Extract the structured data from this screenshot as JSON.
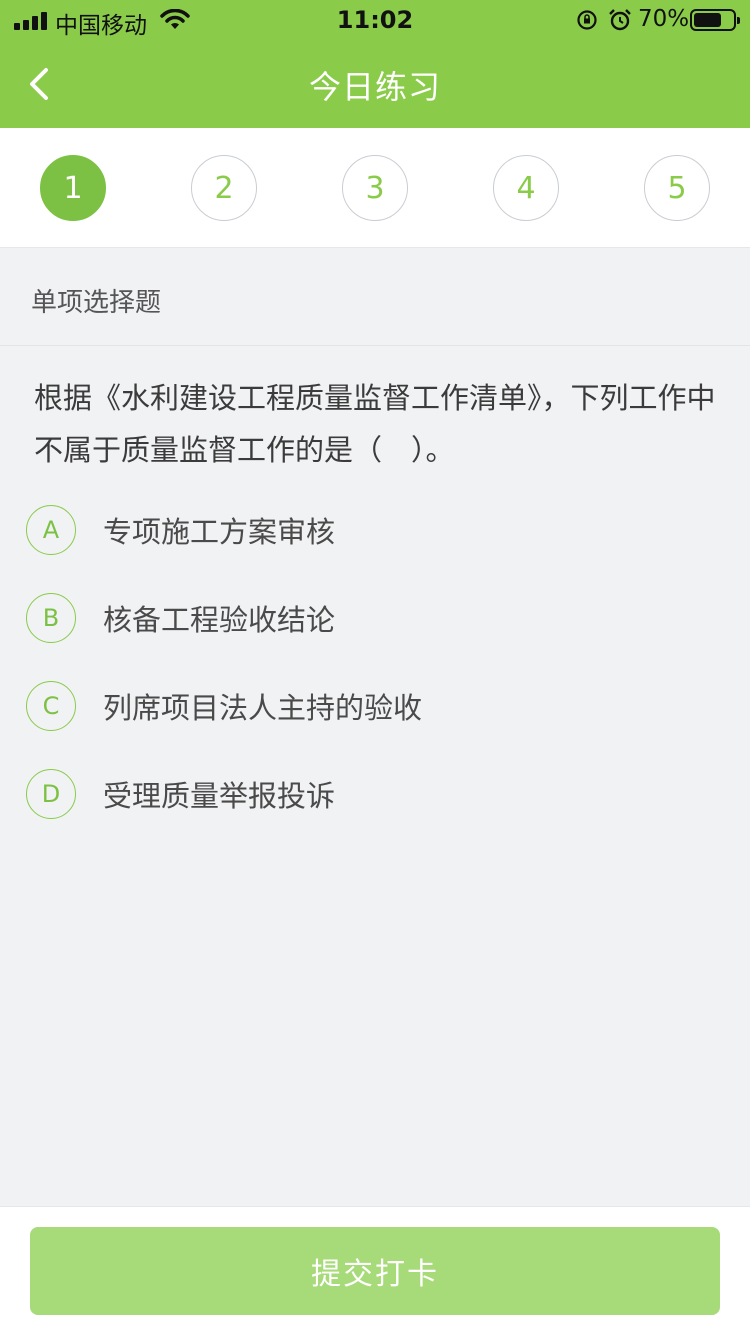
{
  "status_bar": {
    "carrier": "中国移动",
    "time": "11:02",
    "battery_percent": "70%",
    "battery_level": 0.7
  },
  "header": {
    "title": "今日练习",
    "back_icon": "chevron-left-icon",
    "color": "#8acb4a"
  },
  "steps": {
    "items": [
      "1",
      "2",
      "3",
      "4",
      "5"
    ],
    "active_index": 0
  },
  "question": {
    "type": "单项选择题",
    "text": "根据《水利建设工程质量监督工作清单》，下列工作中不属于质量监督工作的是（　）。",
    "options": [
      {
        "key": "A",
        "text": "专项施工方案审核"
      },
      {
        "key": "B",
        "text": "核备工程验收结论"
      },
      {
        "key": "C",
        "text": "列席项目法人主持的验收"
      },
      {
        "key": "D",
        "text": "受理质量举报投诉"
      }
    ]
  },
  "footer": {
    "submit_label": "提交打卡",
    "submit_color": "#a7da78"
  }
}
